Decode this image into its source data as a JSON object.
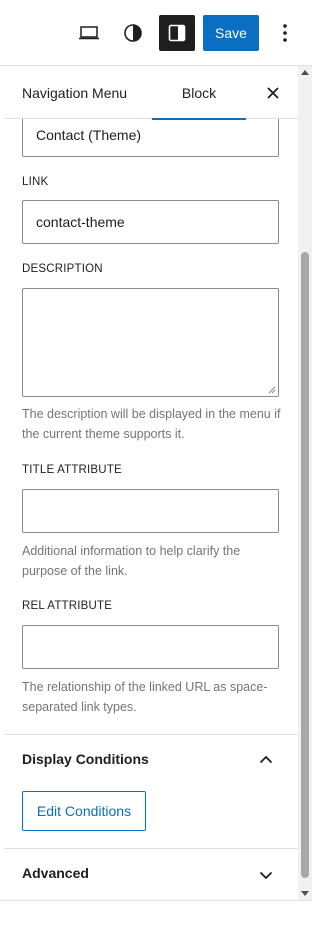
{
  "toolbar": {
    "icons": [
      "laptop-icon",
      "contrast-icon",
      "sidebar-toggle-icon",
      "more-vertical-icon"
    ],
    "save_label": "Save",
    "accent_color": "#0a6ec2"
  },
  "tabs": {
    "items": [
      {
        "label": "Navigation Menu",
        "active": false
      },
      {
        "label": "Block",
        "active": true
      }
    ],
    "close_icon": "close-icon"
  },
  "fields": {
    "label_value": "Contact (Theme)",
    "link": {
      "label": "LINK",
      "value": "contact-theme"
    },
    "description": {
      "label": "DESCRIPTION",
      "value": "",
      "help": "The description will be displayed in the menu if the current theme supports it."
    },
    "title_attribute": {
      "label": "TITLE ATTRIBUTE",
      "value": "",
      "help": "Additional information to help clarify the purpose of the link."
    },
    "rel_attribute": {
      "label": "REL ATTRIBUTE",
      "value": "",
      "help": "The relationship of the linked URL as space-separated link types."
    }
  },
  "sections": {
    "display_conditions": {
      "title": "Display Conditions",
      "expanded": true,
      "button_label": "Edit Conditions"
    },
    "advanced": {
      "title": "Advanced",
      "expanded": false
    }
  }
}
